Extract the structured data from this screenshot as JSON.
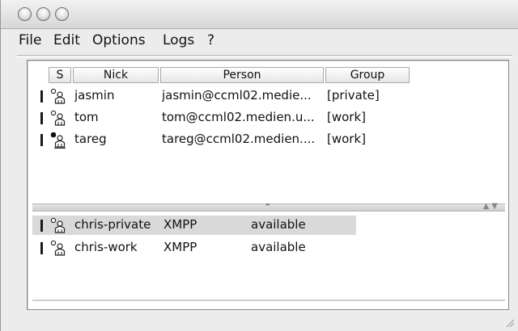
{
  "window": {
    "controls": [
      "close",
      "minimize",
      "zoom"
    ]
  },
  "menu": {
    "items": [
      "File",
      "Edit",
      "Options",
      "Logs",
      "?"
    ]
  },
  "roster": {
    "columns": [
      "S",
      "Nick",
      "Person",
      "Group"
    ],
    "rows": [
      {
        "nick": "jasmin",
        "person": "jasmin@ccml02.medie...",
        "group": "[private]",
        "icon": "contact-offline-icon"
      },
      {
        "nick": "tom",
        "person": "tom@ccml02.medien.u...",
        "group": "[work]",
        "icon": "contact-offline-icon"
      },
      {
        "nick": "tareg",
        "person": "tareg@ccml02.medien....",
        "group": "[work]",
        "icon": "contact-online-icon"
      }
    ]
  },
  "accounts": {
    "rows": [
      {
        "name": "chris-private",
        "protocol": "XMPP",
        "status": "available",
        "selected": true
      },
      {
        "name": "chris-work",
        "protocol": "XMPP",
        "status": "available",
        "selected": false
      }
    ]
  },
  "splitter": {
    "caret": "⌃",
    "arrows": "▲▼"
  }
}
